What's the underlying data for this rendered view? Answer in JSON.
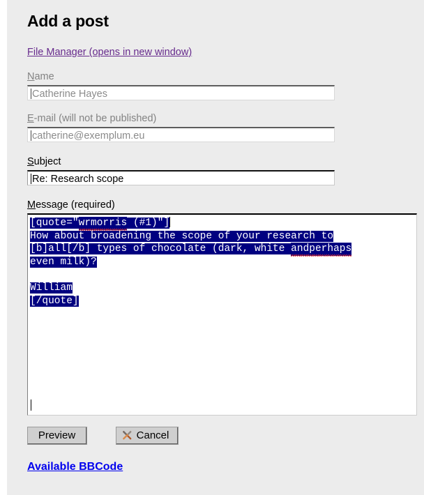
{
  "page": {
    "title": "Add a post",
    "background_color": "#ececec"
  },
  "links": {
    "file_manager": {
      "label": "File Manager (opens in new window)",
      "color": "#662a8c"
    },
    "bbcode": {
      "label": "Available BBCode",
      "color": "#0000ee"
    }
  },
  "form": {
    "name_field": {
      "label_accel": "N",
      "label_rest": "ame",
      "value": "Catherine Hayes",
      "disabled": true
    },
    "email_field": {
      "label_accel": "E",
      "label_rest": "-mail (will not be published)",
      "value": "catherine@exemplum.eu",
      "disabled": true
    },
    "subject_field": {
      "label_accel": "S",
      "label_rest": "ubject",
      "value": "Re: Research scope",
      "disabled": false
    },
    "message_field": {
      "label_accel": "M",
      "label_rest": "essage (required)",
      "selection_color": "#000080",
      "selection_text_color": "#ffffff",
      "lines": {
        "l1_a": "[quote=\"",
        "l1_b": "wrmorris",
        "l1_c": " (#1)\"]",
        "l2": "How about broadening the scope of your research to",
        "l3_a": "[b]all[/b] types of chocolate (dark, white ",
        "l3_b": "andperhaps",
        "l4": "even milk)?",
        "l5": "",
        "l6": "William",
        "l7": "[/quote]"
      }
    }
  },
  "buttons": {
    "preview": {
      "label": "Preview"
    },
    "cancel": {
      "label": "Cancel",
      "icon": "crossed-tools-icon"
    }
  }
}
